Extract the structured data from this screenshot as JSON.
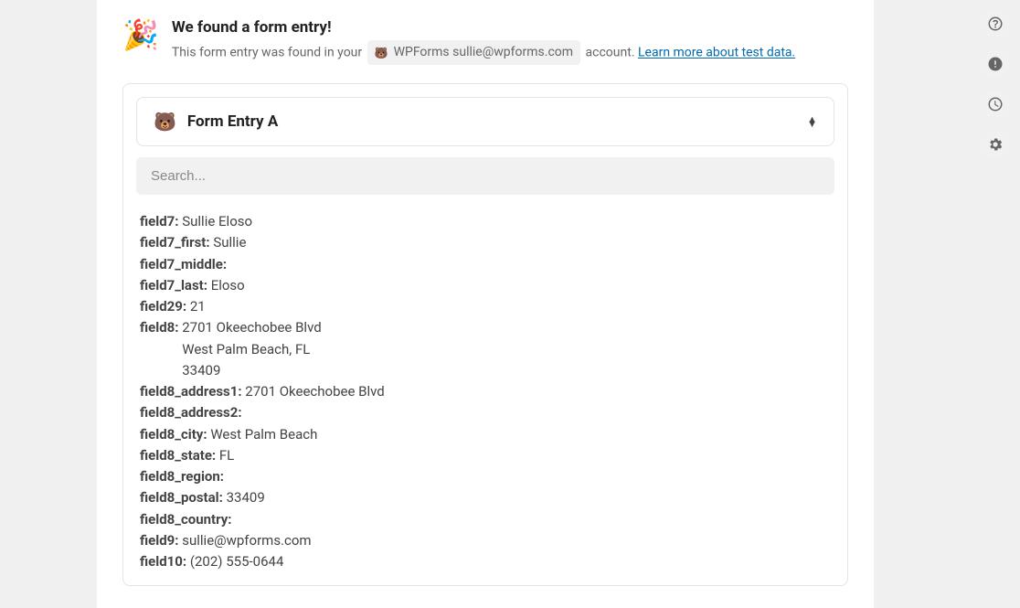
{
  "header": {
    "title": "We found a form entry!",
    "subtitle_prefix": "This form entry was found in your",
    "account_label": "WPForms sullie@wpforms.com",
    "subtitle_suffix": "account.",
    "learn_link": "Learn more about test data."
  },
  "entry": {
    "selector_label": "Form Entry A"
  },
  "search": {
    "placeholder": "Search..."
  },
  "fields": {
    "field7": {
      "label": "field7:",
      "value": "Sullie Eloso"
    },
    "field7_first": {
      "label": "field7_first:",
      "value": "Sullie"
    },
    "field7_middle": {
      "label": "field7_middle:",
      "value": ""
    },
    "field7_last": {
      "label": "field7_last:",
      "value": "Eloso"
    },
    "field29": {
      "label": "field29:",
      "value": "21"
    },
    "field8": {
      "label": "field8:",
      "line1": "2701 Okeechobee Blvd",
      "line2": "West Palm Beach, FL",
      "line3": "33409"
    },
    "field8_address1": {
      "label": "field8_address1:",
      "value": "2701 Okeechobee Blvd"
    },
    "field8_address2": {
      "label": "field8_address2:",
      "value": ""
    },
    "field8_city": {
      "label": "field8_city:",
      "value": "West Palm Beach"
    },
    "field8_state": {
      "label": "field8_state:",
      "value": "FL"
    },
    "field8_region": {
      "label": "field8_region:",
      "value": ""
    },
    "field8_postal": {
      "label": "field8_postal:",
      "value": "33409"
    },
    "field8_country": {
      "label": "field8_country:",
      "value": ""
    },
    "field9": {
      "label": "field9:",
      "value": "sullie@wpforms.com"
    },
    "field10": {
      "label": "field10:",
      "value": "(202) 555-0644"
    }
  }
}
